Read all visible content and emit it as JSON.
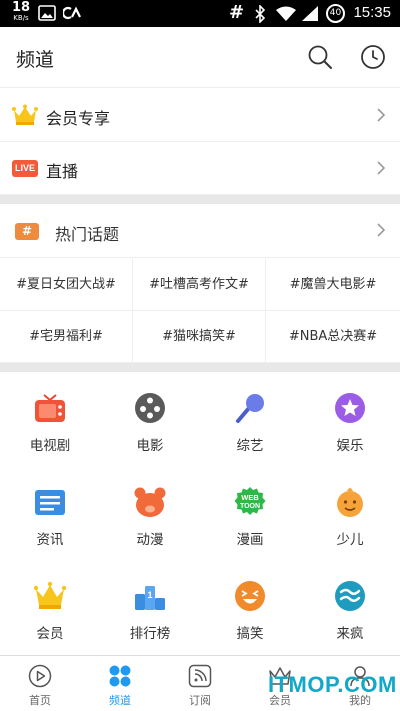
{
  "status_bar": {
    "net_speed": "18",
    "net_speed_unit": "KB/s",
    "battery_level": "40",
    "time": "15:35"
  },
  "header": {
    "title": "频道"
  },
  "vip_row": {
    "label": "会员专享"
  },
  "live_row": {
    "badge": "LIVE",
    "label": "直播"
  },
  "topics": {
    "badge": "#",
    "label": "热门话题",
    "items": [
      "#夏日女团大战#",
      "#吐槽高考作文#",
      "#魔兽大电影#",
      "#宅男福利#",
      "#猫咪搞笑#",
      "#NBA总决赛#"
    ]
  },
  "channels": [
    {
      "label": "电视剧",
      "icon": "tv-icon"
    },
    {
      "label": "电影",
      "icon": "film-reel-icon"
    },
    {
      "label": "综艺",
      "icon": "microphone-icon"
    },
    {
      "label": "娱乐",
      "icon": "star-icon"
    },
    {
      "label": "资讯",
      "icon": "news-icon"
    },
    {
      "label": "动漫",
      "icon": "bear-icon"
    },
    {
      "label": "漫画",
      "icon": "webtoon-icon"
    },
    {
      "label": "少儿",
      "icon": "kid-icon"
    },
    {
      "label": "会员",
      "icon": "crown-icon"
    },
    {
      "label": "排行榜",
      "icon": "podium-icon"
    },
    {
      "label": "搞笑",
      "icon": "laugh-icon"
    },
    {
      "label": "来疯",
      "icon": "laifeng-icon"
    }
  ],
  "channel_icon_texts": {
    "webtoon_line1": "WEB",
    "webtoon_line2": "TOON",
    "podium": "1"
  },
  "bottom_nav": {
    "items": [
      {
        "label": "首页",
        "icon": "play-circle-icon"
      },
      {
        "label": "频道",
        "icon": "grid-dots-icon"
      },
      {
        "label": "订阅",
        "icon": "rss-icon"
      },
      {
        "label": "会员",
        "icon": "crown-outline-icon"
      },
      {
        "label": "我的",
        "icon": "user-icon"
      }
    ],
    "active_index": 1
  },
  "watermark": "ITMOP.COM",
  "colors": {
    "accent": "#1f9af0",
    "live_badge": "#f25a3a",
    "topic_badge": "#f08a3c",
    "watermark": "#12a9c9"
  }
}
